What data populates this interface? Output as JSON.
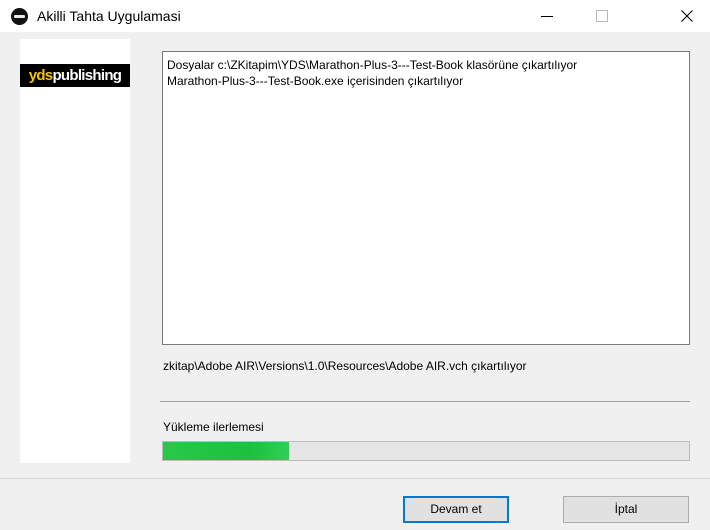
{
  "window": {
    "title": "Akilli Tahta Uygulamasi",
    "icon": "app-icon"
  },
  "titlebar_buttons": {
    "minimize_icon": "minimize-icon",
    "maximize_icon": "maximize-icon",
    "close_icon": "close-icon"
  },
  "logo": {
    "text_part1": "yds",
    "text_part2": "publishing",
    "color_part1": "#f5c400",
    "color_part2": "#ffffff"
  },
  "log": {
    "lines": [
      "Dosyalar c:\\ZKitapim\\YDS\\Marathon-Plus-3---Test-Book klasörüne çıkartılıyor",
      "Marathon-Plus-3---Test-Book.exe içerisinden çıkartılıyor"
    ]
  },
  "status": {
    "current_file": "zkitap\\Adobe AIR\\Versions\\1.0\\Resources\\Adobe AIR.vch çıkartılıyor"
  },
  "progress": {
    "label": "Yükleme ilerlemesi",
    "percent": 24,
    "fill_color": "#26c747"
  },
  "buttons": {
    "continue": "Devam et",
    "cancel": "İptal"
  },
  "colors": {
    "accent": "#0078d7",
    "window_bg": "#f0f0f0"
  }
}
